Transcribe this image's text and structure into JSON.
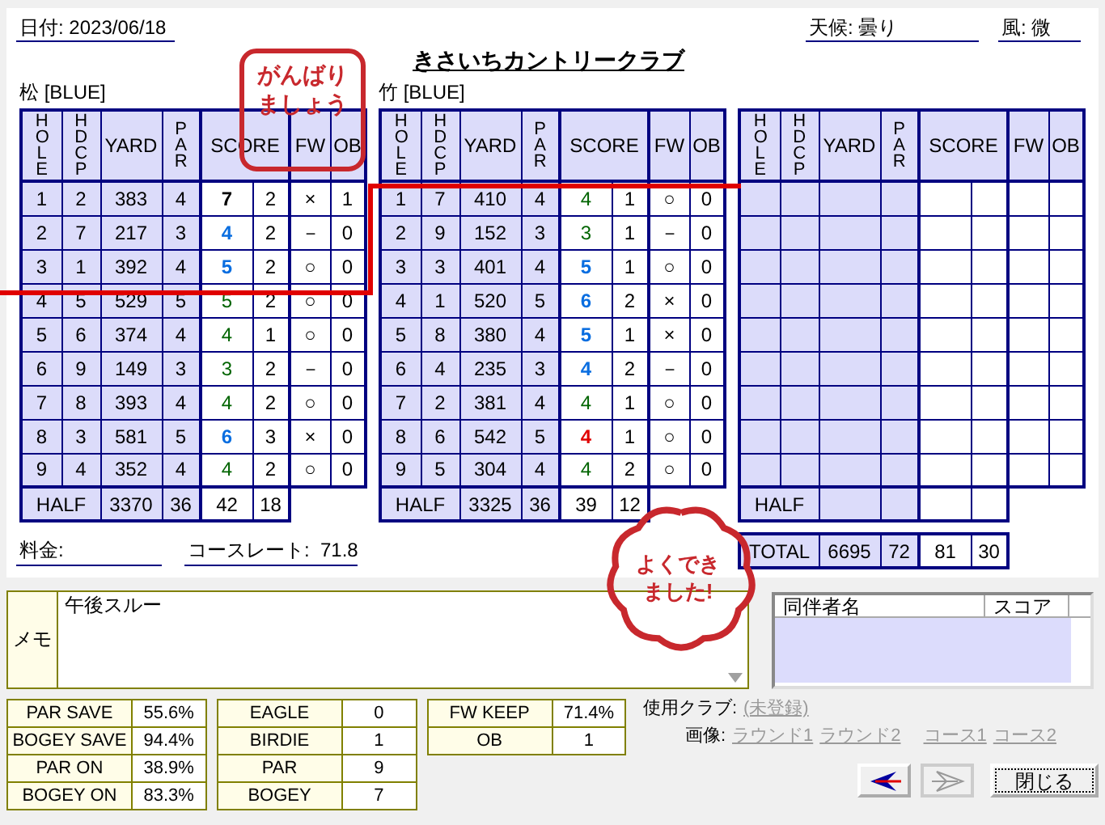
{
  "header": {
    "date_label": "日付:",
    "date": "2023/06/18",
    "title": "きさいちカントリークラブ",
    "weather_label": "天候:",
    "weather": "曇り",
    "wind_label": "風:",
    "wind": "微"
  },
  "courses": [
    {
      "name": "松 [BLUE]",
      "columns": [
        "HOLE",
        "HDCP",
        "YARD",
        "PAR",
        "SCORE",
        "FW",
        "OB"
      ],
      "holes": [
        {
          "hole": "1",
          "hdcp": "2",
          "yard": "383",
          "par": "4",
          "score": "7",
          "color": "#000000",
          "bold": true,
          "putts": "2",
          "fw": "×",
          "ob": "1"
        },
        {
          "hole": "2",
          "hdcp": "7",
          "yard": "217",
          "par": "3",
          "score": "4",
          "color": "#0a6ee0",
          "bold": true,
          "putts": "2",
          "fw": "－",
          "ob": "0"
        },
        {
          "hole": "3",
          "hdcp": "1",
          "yard": "392",
          "par": "4",
          "score": "5",
          "color": "#0a6ee0",
          "bold": true,
          "putts": "2",
          "fw": "○",
          "ob": "0"
        },
        {
          "hole": "4",
          "hdcp": "5",
          "yard": "529",
          "par": "5",
          "score": "5",
          "color": "#006400",
          "bold": false,
          "putts": "2",
          "fw": "○",
          "ob": "0"
        },
        {
          "hole": "5",
          "hdcp": "6",
          "yard": "374",
          "par": "4",
          "score": "4",
          "color": "#006400",
          "bold": false,
          "putts": "1",
          "fw": "○",
          "ob": "0"
        },
        {
          "hole": "6",
          "hdcp": "9",
          "yard": "149",
          "par": "3",
          "score": "3",
          "color": "#006400",
          "bold": false,
          "putts": "2",
          "fw": "－",
          "ob": "0"
        },
        {
          "hole": "7",
          "hdcp": "8",
          "yard": "393",
          "par": "4",
          "score": "4",
          "color": "#006400",
          "bold": false,
          "putts": "2",
          "fw": "○",
          "ob": "0"
        },
        {
          "hole": "8",
          "hdcp": "3",
          "yard": "581",
          "par": "5",
          "score": "6",
          "color": "#0a6ee0",
          "bold": true,
          "putts": "3",
          "fw": "×",
          "ob": "0"
        },
        {
          "hole": "9",
          "hdcp": "4",
          "yard": "352",
          "par": "4",
          "score": "4",
          "color": "#006400",
          "bold": false,
          "putts": "2",
          "fw": "○",
          "ob": "0"
        }
      ],
      "half": {
        "label": "HALF",
        "yard": "3370",
        "par": "36",
        "score": "42",
        "putts": "18"
      }
    },
    {
      "name": "竹 [BLUE]",
      "columns": [
        "HOLE",
        "HDCP",
        "YARD",
        "PAR",
        "SCORE",
        "FW",
        "OB"
      ],
      "holes": [
        {
          "hole": "1",
          "hdcp": "7",
          "yard": "410",
          "par": "4",
          "score": "4",
          "color": "#006400",
          "bold": false,
          "putts": "1",
          "fw": "○",
          "ob": "0"
        },
        {
          "hole": "2",
          "hdcp": "9",
          "yard": "152",
          "par": "3",
          "score": "3",
          "color": "#006400",
          "bold": false,
          "putts": "1",
          "fw": "－",
          "ob": "0"
        },
        {
          "hole": "3",
          "hdcp": "3",
          "yard": "401",
          "par": "4",
          "score": "5",
          "color": "#0a6ee0",
          "bold": true,
          "putts": "1",
          "fw": "○",
          "ob": "0"
        },
        {
          "hole": "4",
          "hdcp": "1",
          "yard": "520",
          "par": "5",
          "score": "6",
          "color": "#0a6ee0",
          "bold": true,
          "putts": "2",
          "fw": "×",
          "ob": "0"
        },
        {
          "hole": "5",
          "hdcp": "8",
          "yard": "380",
          "par": "4",
          "score": "5",
          "color": "#0a6ee0",
          "bold": true,
          "putts": "1",
          "fw": "×",
          "ob": "0"
        },
        {
          "hole": "6",
          "hdcp": "4",
          "yard": "235",
          "par": "3",
          "score": "4",
          "color": "#0a6ee0",
          "bold": true,
          "putts": "2",
          "fw": "－",
          "ob": "0"
        },
        {
          "hole": "7",
          "hdcp": "2",
          "yard": "381",
          "par": "4",
          "score": "4",
          "color": "#006400",
          "bold": false,
          "putts": "1",
          "fw": "○",
          "ob": "0"
        },
        {
          "hole": "8",
          "hdcp": "6",
          "yard": "542",
          "par": "5",
          "score": "4",
          "color": "#e00000",
          "bold": true,
          "putts": "1",
          "fw": "○",
          "ob": "0"
        },
        {
          "hole": "9",
          "hdcp": "5",
          "yard": "304",
          "par": "4",
          "score": "4",
          "color": "#006400",
          "bold": false,
          "putts": "2",
          "fw": "○",
          "ob": "0"
        }
      ],
      "half": {
        "label": "HALF",
        "yard": "3325",
        "par": "36",
        "score": "39",
        "putts": "12"
      }
    },
    {
      "columns": [
        "HOLE",
        "HDCP",
        "YARD",
        "PAR",
        "SCORE",
        "FW",
        "OB"
      ],
      "half": {
        "label": "HALF"
      },
      "total": {
        "label": "TOTAL",
        "yard": "6695",
        "par": "72",
        "score": "81",
        "putts": "30"
      }
    }
  ],
  "fee_label": "料金:",
  "rating_label": "コースレート:",
  "rating": "71.8",
  "memo": {
    "label": "メモ",
    "text": "午後スルー"
  },
  "companions": {
    "columns": [
      "同伴者名",
      "スコア"
    ]
  },
  "stats": [
    [
      {
        "label": "PAR SAVE",
        "value": "55.6%"
      },
      {
        "label": "BOGEY SAVE",
        "value": "94.4%"
      },
      {
        "label": "PAR ON",
        "value": "38.9%"
      },
      {
        "label": "BOGEY ON",
        "value": "83.3%"
      }
    ],
    [
      {
        "label": "EAGLE",
        "value": "0"
      },
      {
        "label": "BIRDIE",
        "value": "1"
      },
      {
        "label": "PAR",
        "value": "9"
      },
      {
        "label": "BOGEY",
        "value": "7"
      }
    ],
    [
      {
        "label": "FW KEEP",
        "value": "71.4%"
      },
      {
        "label": "OB",
        "value": "1"
      }
    ]
  ],
  "clubs": {
    "label": "使用クラブ:",
    "value": "(未登録)",
    "disabled": true
  },
  "images": {
    "label": "画像:",
    "links": [
      {
        "text": "ラウンド1",
        "disabled": true
      },
      {
        "text": "ラウンド2",
        "disabled": true
      },
      {
        "text": "コース1",
        "disabled": true
      },
      {
        "text": "コース2",
        "disabled": true
      }
    ]
  },
  "buttons": [
    {
      "kind": "back",
      "disabled": false
    },
    {
      "kind": "forward",
      "disabled": true
    },
    {
      "kind": "text",
      "text": "閉じる",
      "disabled": false
    }
  ],
  "annotations": [
    {
      "kind": "box",
      "lines": [
        "がんばり",
        "ましょう"
      ]
    },
    {
      "kind": "cloud",
      "lines": [
        "よくでき",
        "ました!"
      ]
    }
  ]
}
